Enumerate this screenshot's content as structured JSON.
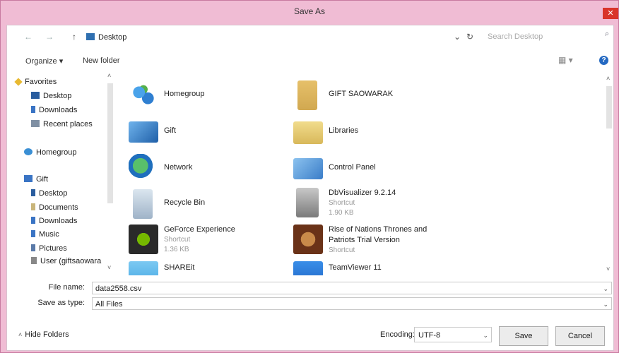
{
  "window": {
    "title": "Save As",
    "close_glyph": "✕"
  },
  "address": {
    "back": "←",
    "forward": "→",
    "up": "↑",
    "path": "Desktop",
    "dropdown": "⌄",
    "refresh": "↻"
  },
  "search": {
    "placeholder": "Search Desktop",
    "icon": "⌕"
  },
  "toolbar": {
    "organize": "Organize ▾",
    "new_folder": "New folder",
    "view": "▦ ▾",
    "help": "?"
  },
  "nav": {
    "items": [
      {
        "label": "Favorites",
        "icon": "star-icon",
        "color": "#e8b931"
      },
      {
        "label": "Desktop",
        "icon": "desktop-icon",
        "color": "#2a5d9e"
      },
      {
        "label": "Downloads",
        "icon": "downloads-icon",
        "color": "#3a74c4"
      },
      {
        "label": "Recent places",
        "icon": "recent-places-icon",
        "color": "#7f8fa3"
      },
      {
        "label": "Homegroup",
        "icon": "homegroup-icon",
        "color": "#3a8fd4"
      },
      {
        "label": "Gift",
        "icon": "user-icon",
        "color": "#3a74c4"
      },
      {
        "label": "Desktop",
        "icon": "desktop-icon",
        "color": "#2a5d9e"
      },
      {
        "label": "Documents",
        "icon": "documents-icon",
        "color": "#c9b57a"
      },
      {
        "label": "Downloads",
        "icon": "downloads-icon",
        "color": "#3a74c4"
      },
      {
        "label": "Music",
        "icon": "music-icon",
        "color": "#3a74c4"
      },
      {
        "label": "Pictures",
        "icon": "pictures-icon",
        "color": "#5a7aa8"
      },
      {
        "label": "User (giftsaowara",
        "icon": "drive-icon",
        "color": "#888888"
      }
    ]
  },
  "files": [
    {
      "name": "Homegroup",
      "sub1": "",
      "sub2": "",
      "icon": "homegroup-icon",
      "color": "#2f7fd1"
    },
    {
      "name": "GIFT SAOWARAK",
      "sub1": "",
      "sub2": "",
      "icon": "user-folder-icon",
      "color": "#e6c06a"
    },
    {
      "name": "Gift",
      "sub1": "",
      "sub2": "",
      "icon": "computer-icon",
      "color": "#3a7cc8"
    },
    {
      "name": "Libraries",
      "sub1": "",
      "sub2": "",
      "icon": "libraries-icon",
      "color": "#e9cf7a"
    },
    {
      "name": "Network",
      "sub1": "",
      "sub2": "",
      "icon": "network-icon",
      "color": "#2e8d4a"
    },
    {
      "name": "Control Panel",
      "sub1": "",
      "sub2": "",
      "icon": "control-panel-icon",
      "color": "#5a9bd6"
    },
    {
      "name": "Recycle Bin",
      "sub1": "",
      "sub2": "",
      "icon": "recycle-bin-icon",
      "color": "#9fb3c8"
    },
    {
      "name": "DbVisualizer 9.2.14",
      "sub1": "Shortcut",
      "sub2": "1.90 KB",
      "icon": "database-icon",
      "color": "#8a8a8a"
    },
    {
      "name": "GeForce Experience",
      "sub1": "Shortcut",
      "sub2": "1.36 KB",
      "icon": "nvidia-icon",
      "color": "#2a2a2a"
    },
    {
      "name": "Rise of Nations Thrones and Patriots Trial Version",
      "sub1": "Shortcut",
      "sub2": "",
      "icon": "game-icon",
      "color": "#8a4a2a"
    },
    {
      "name": "SHAREit",
      "sub1": "",
      "sub2": "",
      "icon": "shareit-icon",
      "color": "#3aa0e0"
    },
    {
      "name": "TeamViewer 11",
      "sub1": "",
      "sub2": "",
      "icon": "teamviewer-icon",
      "color": "#1a6fd0"
    }
  ],
  "fields": {
    "file_name_label": "File name:",
    "file_name_value": "data2558.csv",
    "save_type_label": "Save as type:",
    "save_type_value": "All Files"
  },
  "footer": {
    "hide_folders": "Hide Folders",
    "encoding_label": "Encoding:",
    "encoding_value": "UTF-8",
    "save": "Save",
    "cancel": "Cancel"
  }
}
